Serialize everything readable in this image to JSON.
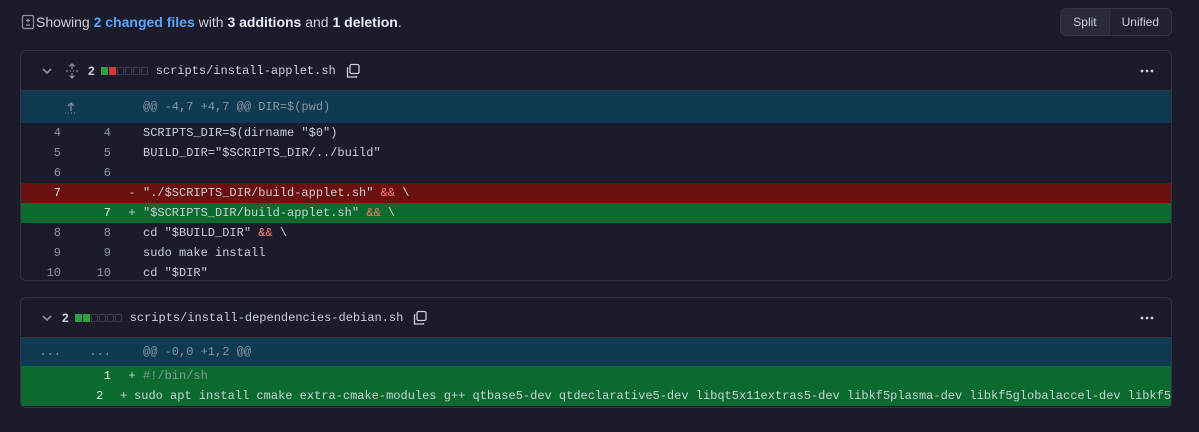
{
  "summary": {
    "prefix": "Showing ",
    "changed_files": "2 changed files",
    "with": " with ",
    "additions": "3 additions",
    "and": " and ",
    "deletions": "1 deletion",
    "suffix": "."
  },
  "view_toggle": {
    "split": "Split",
    "unified": "Unified",
    "active": "split"
  },
  "files": [
    {
      "count": "2",
      "blocks": [
        "g",
        "r",
        "n",
        "n",
        "n",
        "n"
      ],
      "name": "scripts/install-applet.sh",
      "hunk": "@@ -4,7 +4,7 @@ DIR=$(pwd)",
      "lines": [
        {
          "old": "4",
          "new": "4",
          "sign": " ",
          "type": "ctx",
          "text": "SCRIPTS_DIR=$(dirname \"$0\")"
        },
        {
          "old": "5",
          "new": "5",
          "sign": " ",
          "type": "ctx",
          "text": "BUILD_DIR=\"$SCRIPTS_DIR/../build\""
        },
        {
          "old": "6",
          "new": "6",
          "sign": " ",
          "type": "ctx",
          "text": ""
        },
        {
          "old": "7",
          "new": "",
          "sign": "-",
          "type": "del",
          "text": "\"./$SCRIPTS_DIR/build-applet.sh\" ",
          "kw": "&&",
          "tail": " \\"
        },
        {
          "old": "",
          "new": "7",
          "sign": "+",
          "type": "add",
          "text": "\"$SCRIPTS_DIR/build-applet.sh\" ",
          "kw": "&&",
          "tail": " \\"
        },
        {
          "old": "8",
          "new": "8",
          "sign": " ",
          "type": "ctx",
          "text": "cd \"$BUILD_DIR\" ",
          "kw": "&&",
          "tail": " \\"
        },
        {
          "old": "9",
          "new": "9",
          "sign": " ",
          "type": "ctx",
          "text": "sudo make install"
        },
        {
          "old": "10",
          "new": "10",
          "sign": " ",
          "type": "ctx",
          "text": "cd \"$DIR\""
        }
      ]
    },
    {
      "count": "2",
      "blocks": [
        "g",
        "g",
        "n",
        "n",
        "n",
        "n"
      ],
      "name": "scripts/install-dependencies-debian.sh",
      "hunk_old": "...",
      "hunk_new": "...",
      "hunk": "@@ -0,0 +1,2 @@",
      "lines": [
        {
          "old": "",
          "new": "1",
          "sign": "+",
          "type": "add",
          "text": "#!/bin/sh"
        },
        {
          "old": "",
          "new": "2",
          "sign": "+",
          "type": "add",
          "text": "sudo apt install cmake extra-cmake-modules g++ qtbase5-dev qtdeclarative5-dev libqt5x11extras5-dev libkf5plasma-dev libkf5globalaccel-dev libkf5"
        }
      ]
    }
  ]
}
